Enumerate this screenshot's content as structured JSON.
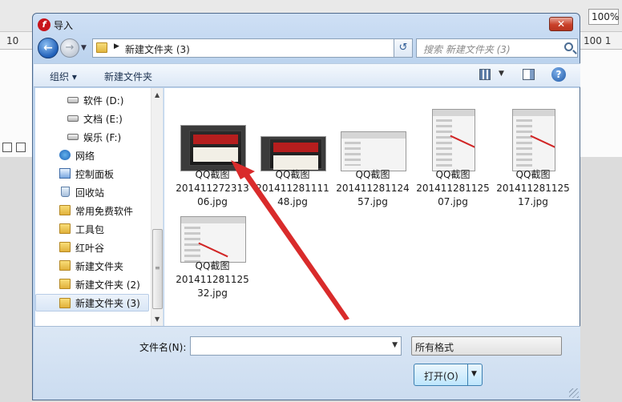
{
  "background": {
    "zoom": "100%",
    "ruler_left": "10",
    "ruler_right": "100  1"
  },
  "dialog": {
    "title": "导入",
    "close_label": "✕",
    "address": {
      "path": "新建文件夹 (3)"
    },
    "search": {
      "placeholder": "搜索 新建文件夹 (3)"
    },
    "toolbar": {
      "organize_label": "组织 ▾",
      "new_folder_label": "新建文件夹",
      "help_label": "?"
    },
    "sidebar": {
      "items": [
        {
          "label": "软件 (D:)",
          "icon": "drive-icon"
        },
        {
          "label": "文档 (E:)",
          "icon": "drive-icon"
        },
        {
          "label": "娱乐 (F:)",
          "icon": "drive-icon"
        },
        {
          "label": "网络",
          "icon": "network-icon"
        },
        {
          "label": "控制面板",
          "icon": "control-panel-icon"
        },
        {
          "label": "回收站",
          "icon": "recycle-bin-icon"
        },
        {
          "label": "常用免费软件",
          "icon": "folder-icon"
        },
        {
          "label": "工具包",
          "icon": "folder-icon"
        },
        {
          "label": "红叶谷",
          "icon": "folder-icon"
        },
        {
          "label": "新建文件夹",
          "icon": "folder-icon"
        },
        {
          "label": "新建文件夹 (2)",
          "icon": "folder-icon"
        },
        {
          "label": "新建文件夹 (3)",
          "icon": "folder-icon",
          "selected": true
        }
      ]
    },
    "files": [
      {
        "line1": "QQ截图",
        "line2": "201411272313",
        "line3": "06.jpg"
      },
      {
        "line1": "QQ截图",
        "line2": "201411281111",
        "line3": "48.jpg"
      },
      {
        "line1": "QQ截图",
        "line2": "201411281124",
        "line3": "57.jpg"
      },
      {
        "line1": "QQ截图",
        "line2": "201411281125",
        "line3": "07.jpg"
      },
      {
        "line1": "QQ截图",
        "line2": "201411281125",
        "line3": "17.jpg"
      },
      {
        "line1": "QQ截图",
        "line2": "201411281125",
        "line3": "32.jpg"
      }
    ],
    "filename": {
      "label": "文件名(N):",
      "value": ""
    },
    "filter": {
      "selected": "所有格式"
    },
    "open_button": {
      "label": "打开(O)"
    },
    "colors": {
      "accent": "#3c7fb1",
      "arrow": "#d92b2b",
      "title_icon": "#c8141b"
    }
  }
}
